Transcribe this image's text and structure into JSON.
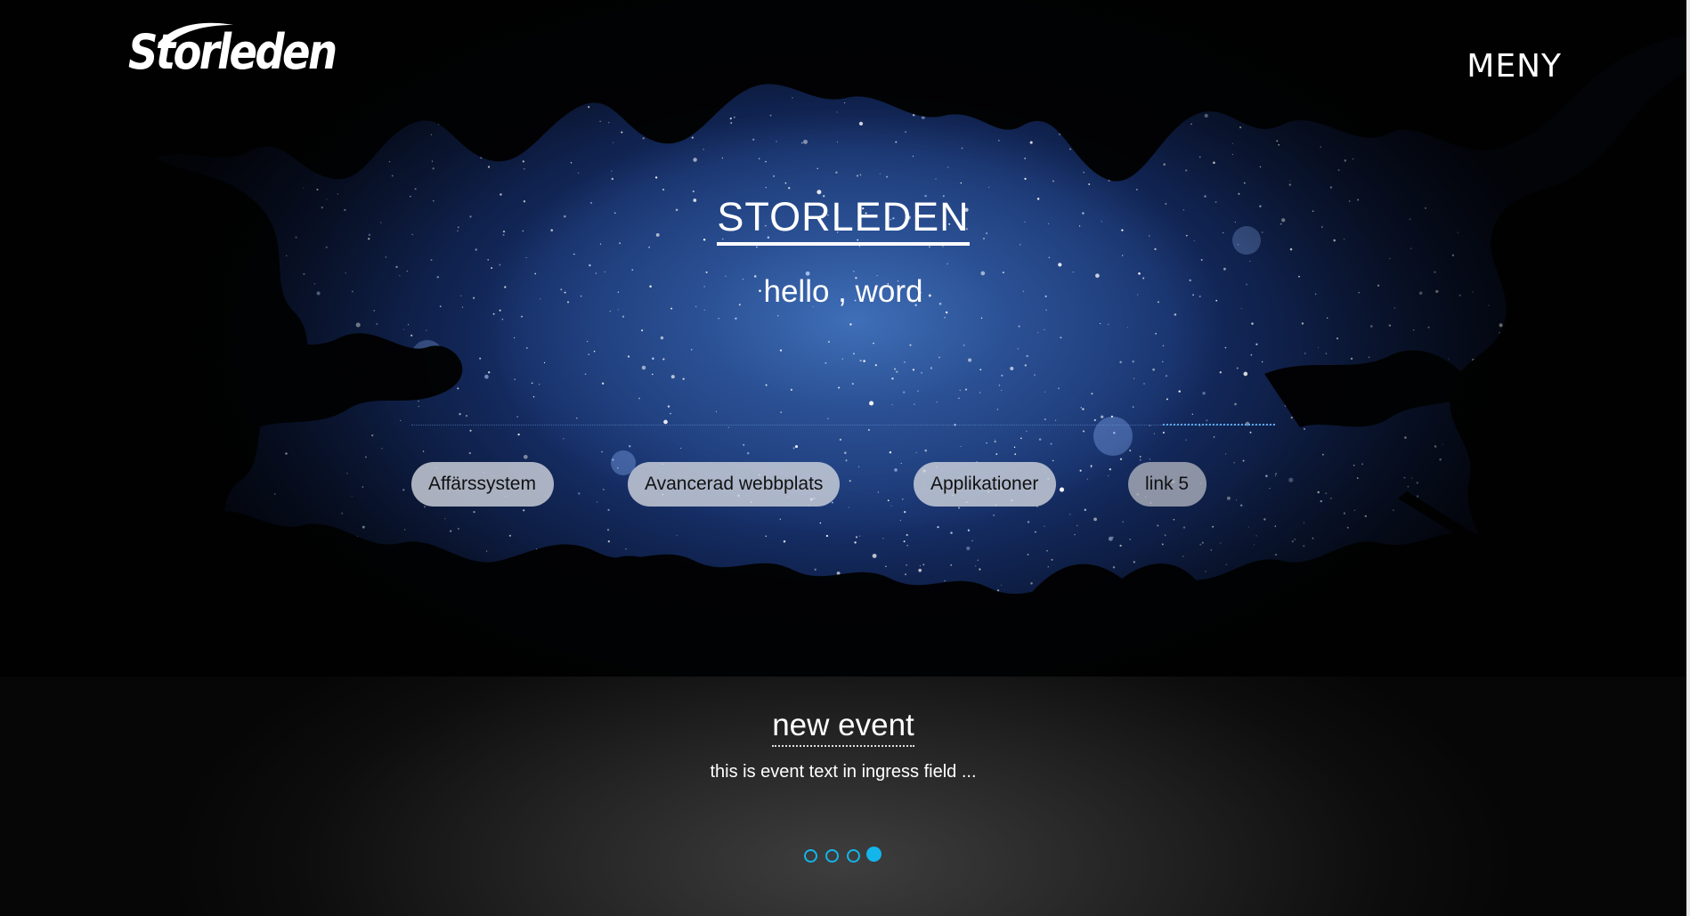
{
  "header": {
    "logo_text": "Storleden",
    "menu_label": "MENY"
  },
  "hero": {
    "title": "STORLEDEN",
    "subtitle": "hello , word",
    "links": [
      {
        "label": "Affärssystem"
      },
      {
        "label": "Avancerad webbplats"
      },
      {
        "label": "Applikationer"
      },
      {
        "label": "link 5"
      }
    ]
  },
  "event": {
    "title": "new event",
    "text": "this is event text in ingress field ...",
    "slides": {
      "count": 4,
      "active_index": 4
    }
  },
  "colors": {
    "accent": "#13b5ea",
    "sky": "#2a4f92",
    "event_bg": "#262626"
  },
  "icons": {
    "background": "starry-night-forest-image",
    "indicator": "carousel-dot"
  }
}
